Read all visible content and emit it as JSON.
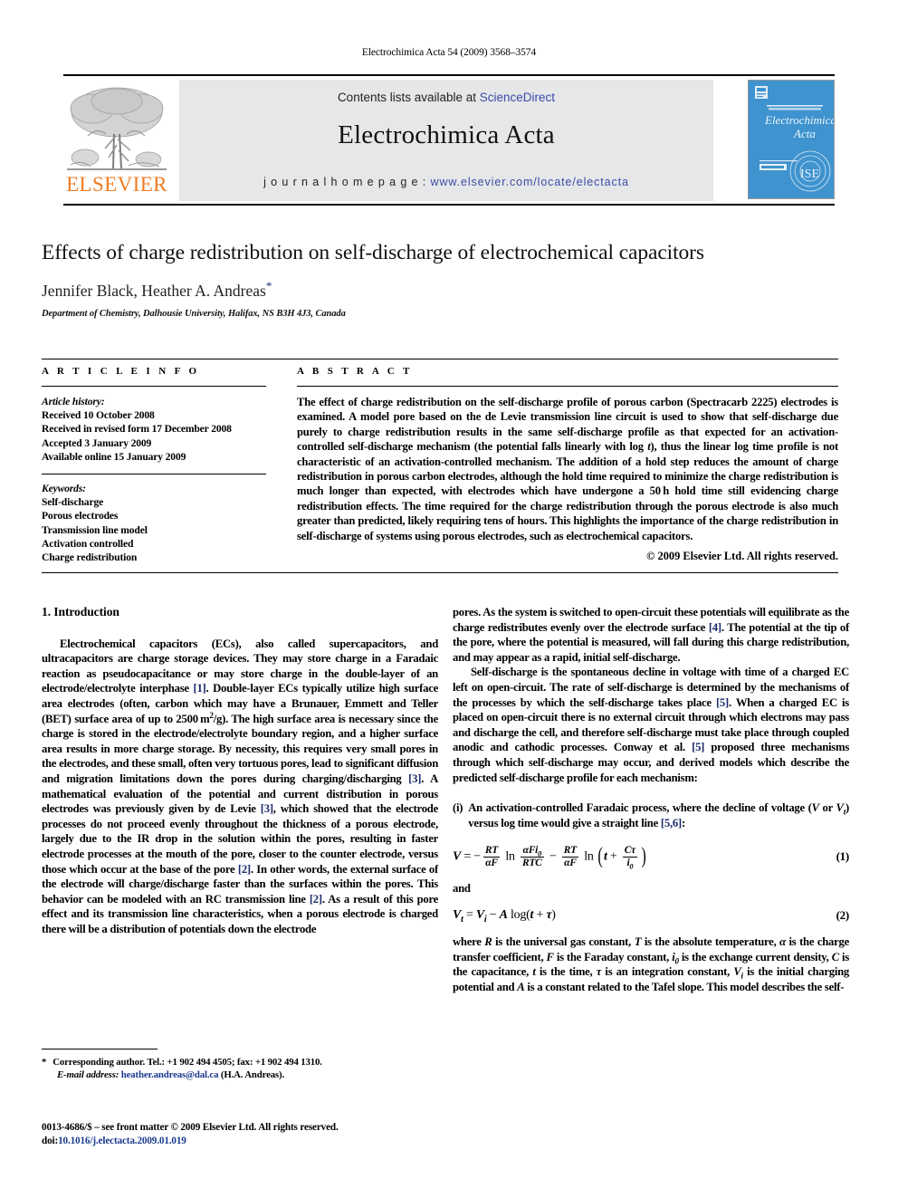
{
  "running_head": "Electrochimica Acta 54 (2009) 3568–3574",
  "masthead": {
    "contents_prefix": "Contents lists available at ",
    "sciencedirect": "ScienceDirect",
    "journal_title": "Electrochimica Acta",
    "homepage_prefix": "j o u r n a l   h o m e p a g e :   ",
    "homepage_url": "www.elsevier.com/locate/electacta",
    "publisher_wordmark": "ELSEVIER",
    "cover_journal_name_line1": "Electrochimica",
    "cover_journal_name_line2": "Acta",
    "colors": {
      "elsevier_orange": "#F07C23",
      "link_blue": "#3b4ba8",
      "band_grey": "#e6e7e8",
      "cover_blue": "#3f93cf"
    }
  },
  "title": "Effects of charge redistribution on self-discharge of electrochemical capacitors",
  "authors": "Jennifer Black, Heather A. Andreas",
  "author_star": "*",
  "affiliation": "Department of Chemistry, Dalhousie University, Halifax, NS B3H 4J3, Canada",
  "article_info": {
    "label": "A R T I C L E   I N F O",
    "history_label": "Article history:",
    "history": [
      "Received 10 October 2008",
      "Received in revised form 17 December 2008",
      "Accepted 3 January 2009",
      "Available online 15 January 2009"
    ],
    "keywords_label": "Keywords:",
    "keywords": [
      "Self-discharge",
      "Porous electrodes",
      "Transmission line model",
      "Activation controlled",
      "Charge redistribution"
    ]
  },
  "abstract": {
    "label": "A B S T R A C T",
    "text": "The effect of charge redistribution on the self-discharge profile of porous carbon (Spectracarb 2225) electrodes is examined. A model pore based on the de Levie transmission line circuit is used to show that self-discharge due purely to charge redistribution results in the same self-discharge profile as that expected for an activation-controlled self-discharge mechanism (the potential falls linearly with log t), thus the linear log time profile is not characteristic of an activation-controlled mechanism. The addition of a hold step reduces the amount of charge redistribution in porous carbon electrodes, although the hold time required to minimize the charge redistribution is much longer than expected, with electrodes which have undergone a 50 h hold time still evidencing charge redistribution effects. The time required for the charge redistribution through the porous electrode is also much greater than predicted, likely requiring tens of hours. This highlights the importance of the charge redistribution in self-discharge of systems using porous electrodes, such as electrochemical capacitors.",
    "copyright": "© 2009 Elsevier Ltd. All rights reserved."
  },
  "body": {
    "section_heading": "1.  Introduction",
    "left_paragraphs": [
      "Electrochemical capacitors (ECs), also called supercapacitors, and ultracapacitors are charge storage devices. They may store charge in a Faradaic reaction as pseudocapacitance or may store charge in the double-layer of an electrode/electrolyte interphase [1]. Double-layer ECs typically utilize high surface area electrodes (often, carbon which may have a Brunauer, Emmett and Teller (BET) surface area of up to 2500 m2/g). The high surface area is necessary since the charge is stored in the electrode/electrolyte boundary region, and a higher surface area results in more charge storage. By necessity, this requires very small pores in the electrodes, and these small, often very tortuous pores, lead to significant diffusion and migration limitations down the pores during charging/discharging [3]. A mathematical evaluation of the potential and current distribution in porous electrodes was previously given by de Levie [3], which showed that the electrode processes do not proceed evenly throughout the thickness of a porous electrode, largely due to the IR drop in the solution within the pores, resulting in faster electrode processes at the mouth of the pore, closer to the counter electrode, versus those which occur at the base of the pore [2]. In other words, the external surface of the electrode will charge/discharge faster than the surfaces within the pores. This behavior can be modeled with an RC transmission line [2]. As a result of this pore effect and its transmission line characteristics, when a porous electrode is charged there will be a distribution of potentials down the electrode"
    ],
    "right_paragraph_1_continued": "pores. As the system is switched to open-circuit these potentials will equilibrate as the charge redistributes evenly over the electrode surface [4]. The potential at the tip of the pore, where the potential is measured, will fall during this charge redistribution, and may appear as a rapid, initial self-discharge.",
    "right_paragraph_2": "Self-discharge is the spontaneous decline in voltage with time of a charged EC left on open-circuit. The rate of self-discharge is determined by the mechanisms of the processes by which the self-discharge takes place [5]. When a charged EC is placed on open-circuit there is no external circuit through which electrons may pass and discharge the cell, and therefore self-discharge must take place through coupled anodic and cathodic processes. Conway et al. [5] proposed three mechanisms through which self-discharge may occur, and derived models which describe the predicted self-discharge profile for each mechanism:",
    "list_item_number": "(i)",
    "list_item_text": "An activation-controlled Faradaic process, where the decline of voltage (V or Vt) versus log time would give a straight line [5,6]:",
    "equation_1_number": "(1)",
    "equation_2_number": "(2)",
    "and_word": "and",
    "where_paragraph": "where R is the universal gas constant, T is the absolute temperature, α is the charge transfer coefficient, F is the Faraday constant, i0 is the exchange current density, C is the capacitance, t is the time, τ is an integration constant, Vi is the initial charging potential and A is a constant related to the Tafel slope. This model describes the self-"
  },
  "footnote": {
    "star": "*",
    "corresponding": "Corresponding author. Tel.: +1 902 494 4505; fax: +1 902 494 1310.",
    "email_label": "E-mail address:",
    "email": "heather.andreas@dal.ca",
    "email_suffix": "(H.A. Andreas)."
  },
  "imprint": {
    "line1": "0013-4686/$ – see front matter © 2009 Elsevier Ltd. All rights reserved.",
    "doi_label": "doi:",
    "doi": "10.1016/j.electacta.2009.01.019"
  }
}
